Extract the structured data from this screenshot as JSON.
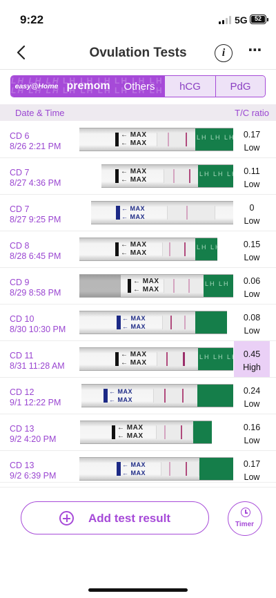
{
  "status_bar": {
    "time": "9:22",
    "network": "5G",
    "battery": "52"
  },
  "header": {
    "title": "Ovulation Tests",
    "info_icon": "i",
    "more_icon": "⋯"
  },
  "tabs": [
    {
      "label": "easy@Home",
      "selected": true
    },
    {
      "label": "premom",
      "selected": true
    },
    {
      "label": "Others",
      "selected": true
    },
    {
      "label": "hCG",
      "selected": false
    },
    {
      "label": "PdG",
      "selected": false
    }
  ],
  "table": {
    "col_date": "Date & Time",
    "col_ratio": "T/C ratio",
    "rows": [
      {
        "cd": "CD 6",
        "datetime": "8/26 2:21 PM",
        "ratio": "0.17",
        "level": "Low",
        "high": false
      },
      {
        "cd": "CD 7",
        "datetime": "8/27 4:36 PM",
        "ratio": "0.11",
        "level": "Low",
        "high": false
      },
      {
        "cd": "CD 7",
        "datetime": "8/27 9:25 PM",
        "ratio": "0",
        "level": "Low",
        "high": false
      },
      {
        "cd": "CD 8",
        "datetime": "8/28 6:45 PM",
        "ratio": "0.15",
        "level": "Low",
        "high": false
      },
      {
        "cd": "CD 9",
        "datetime": "8/29 8:58 PM",
        "ratio": "0.06",
        "level": "Low",
        "high": false
      },
      {
        "cd": "CD 10",
        "datetime": "8/30 10:30 PM",
        "ratio": "0.08",
        "level": "Low",
        "high": false
      },
      {
        "cd": "CD 11",
        "datetime": "8/31 11:28 AM",
        "ratio": "0.45",
        "level": "High",
        "high": true
      },
      {
        "cd": "CD 12",
        "datetime": "9/1 12:22 PM",
        "ratio": "0.24",
        "level": "Low",
        "high": false
      },
      {
        "cd": "CD 13",
        "datetime": "9/2 4:20 PM",
        "ratio": "0.16",
        "level": "Low",
        "high": false
      },
      {
        "cd": "CD 13",
        "datetime": "9/2 6:39 PM",
        "ratio": "0.17",
        "level": "Low",
        "high": false
      }
    ]
  },
  "actions": {
    "add_label": "Add test result",
    "timer_label": "Timer"
  },
  "colors": {
    "accent": "#a64ad8",
    "high_bg": "#ead0f6",
    "header_bg": "#eeeaf0"
  }
}
